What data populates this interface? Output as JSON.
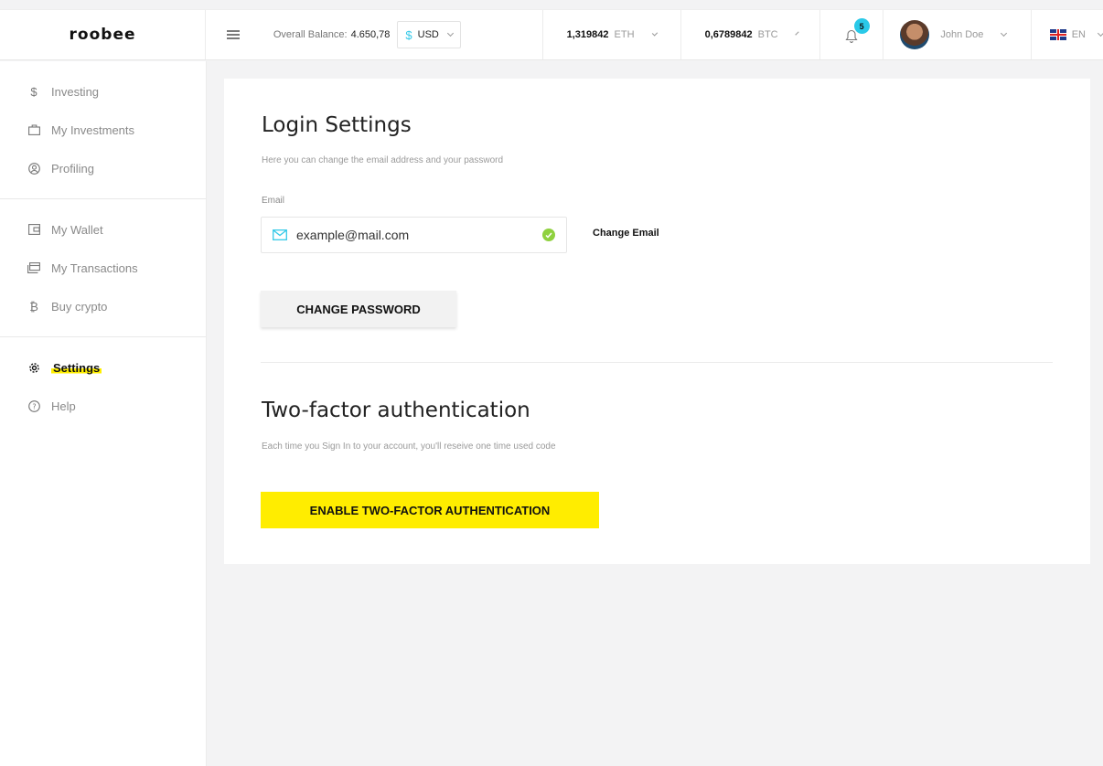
{
  "brand": {
    "logo": "roobee"
  },
  "header": {
    "balance_label": "Overall Balance:",
    "balance_value": "4.650,78",
    "currency_symbol": "$",
    "currency": "USD",
    "eth_amount": "1,319842",
    "eth_symbol": "ETH",
    "btc_amount": "0,6789842",
    "btc_symbol": "BTC",
    "notifications_count": "5",
    "user_name": "John Doe",
    "language": "EN"
  },
  "sidebar": {
    "groups": [
      [
        {
          "label": "Investing",
          "icon": "dollar-icon"
        },
        {
          "label": "My Investments",
          "icon": "briefcase-icon"
        },
        {
          "label": "Profiling",
          "icon": "user-circle-icon"
        }
      ],
      [
        {
          "label": "My Wallet",
          "icon": "wallet-icon"
        },
        {
          "label": "My Transactions",
          "icon": "transactions-icon"
        },
        {
          "label": "Buy crypto",
          "icon": "bitcoin-icon"
        }
      ],
      [
        {
          "label": "Settings",
          "icon": "gear-icon",
          "active": true
        },
        {
          "label": "Help",
          "icon": "help-icon"
        }
      ]
    ]
  },
  "login_settings": {
    "title": "Login Settings",
    "subtitle": "Here you can change the email address and your password",
    "email_label": "Email",
    "email_value": "example@mail.com",
    "change_email_label": "Change Email",
    "change_password_label": "CHANGE PASSWORD"
  },
  "two_factor": {
    "title": "Two-factor authentication",
    "subtitle": "Each time you Sign In to your account, you'll reseive one time used code",
    "enable_label": "ENABLE TWO-FACTOR AUTHENTICATION"
  },
  "colors": {
    "accent_yellow": "#ffed00",
    "accent_cyan": "#2ac9e8",
    "success_green": "#8fd13f"
  }
}
